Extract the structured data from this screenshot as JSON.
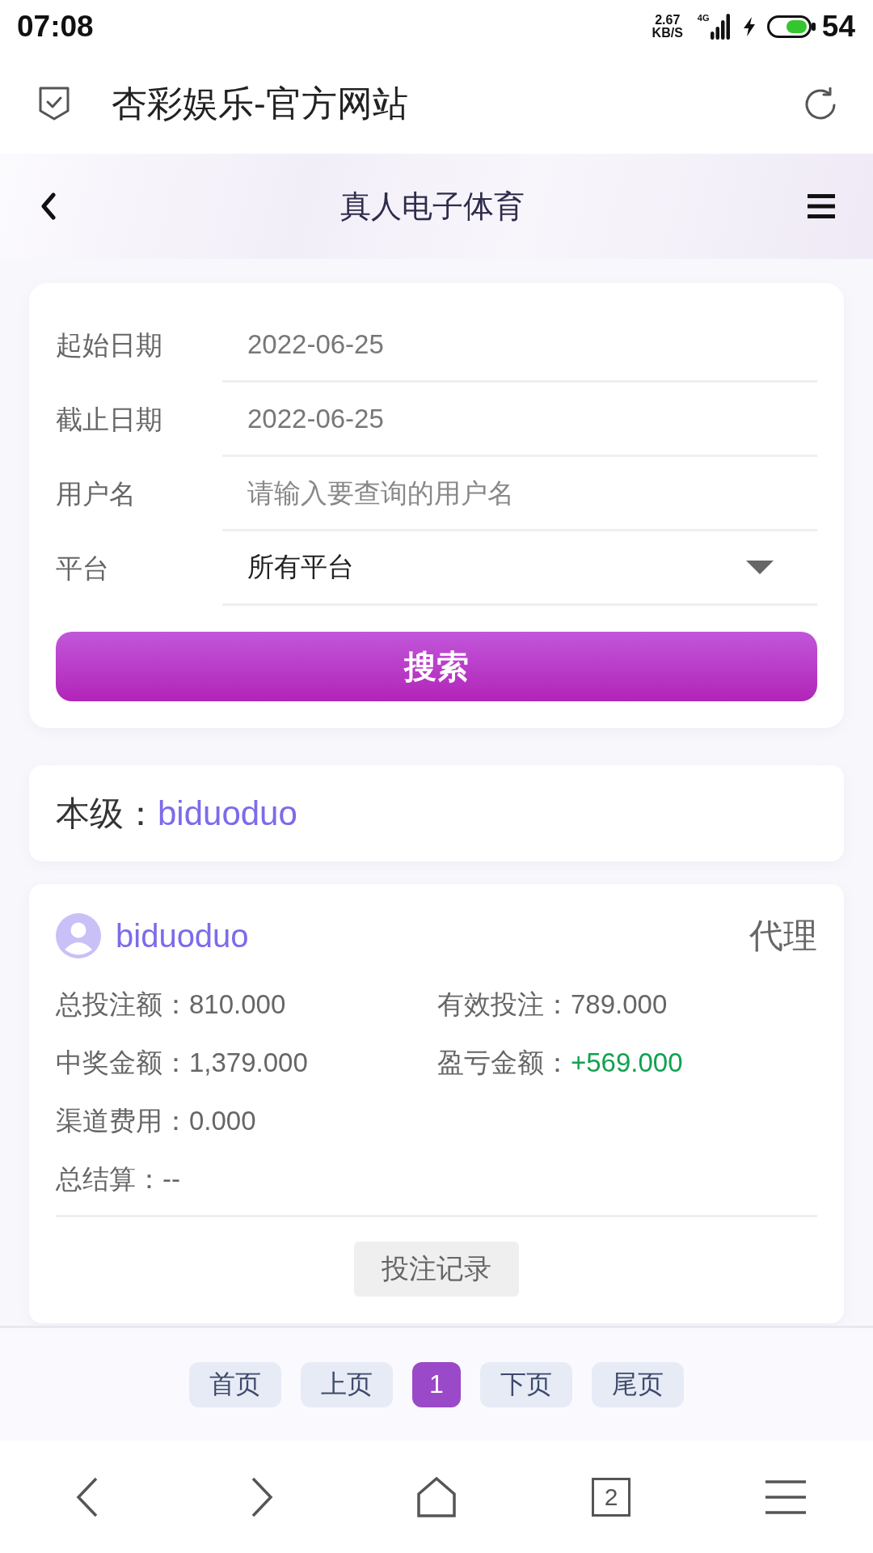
{
  "status_bar": {
    "time": "07:08",
    "net_speed": "2.67",
    "net_speed_unit": "KB/S",
    "network_type": "4G",
    "battery_percent": "54"
  },
  "address_bar": {
    "title": "杏彩娱乐-官方网站"
  },
  "header": {
    "title": "真人电子体育"
  },
  "filter_form": {
    "fields": [
      {
        "kind": "date",
        "label": "起始日期",
        "value": "2022-06-25"
      },
      {
        "kind": "date",
        "label": "截止日期",
        "value": "2022-06-25"
      },
      {
        "kind": "text",
        "label": "用户名",
        "placeholder": "请输入要查询的用户名"
      },
      {
        "kind": "select",
        "label": "平台",
        "value": "所有平台"
      }
    ],
    "search_button": "搜索"
  },
  "current_level": {
    "label": "本级：",
    "username": "biduoduo"
  },
  "user_card": {
    "username": "biduoduo",
    "role": "代理",
    "stat_rows": [
      [
        {
          "kind": "plain",
          "label": "总投注额：",
          "value": "810.000"
        },
        {
          "kind": "plain",
          "label": "有效投注：",
          "value": "789.000"
        }
      ],
      [
        {
          "kind": "plain",
          "label": "中奖金额：",
          "value": "1,379.000"
        },
        {
          "kind": "gain",
          "label": "盈亏金额：",
          "value": "+569.000"
        }
      ],
      [
        {
          "kind": "plain",
          "label": "渠道费用：",
          "value": "0.000"
        }
      ],
      [
        {
          "kind": "plain",
          "label": "总结算：",
          "value": "--"
        }
      ]
    ],
    "records_button": "投注记录"
  },
  "pagination": {
    "buttons": [
      {
        "label": "首页",
        "selected": false
      },
      {
        "label": "上页",
        "selected": false
      },
      {
        "label": "1",
        "selected": true
      },
      {
        "label": "下页",
        "selected": false
      },
      {
        "label": "尾页",
        "selected": false
      }
    ]
  },
  "browser_toolbar": {
    "tab_count": "2"
  }
}
